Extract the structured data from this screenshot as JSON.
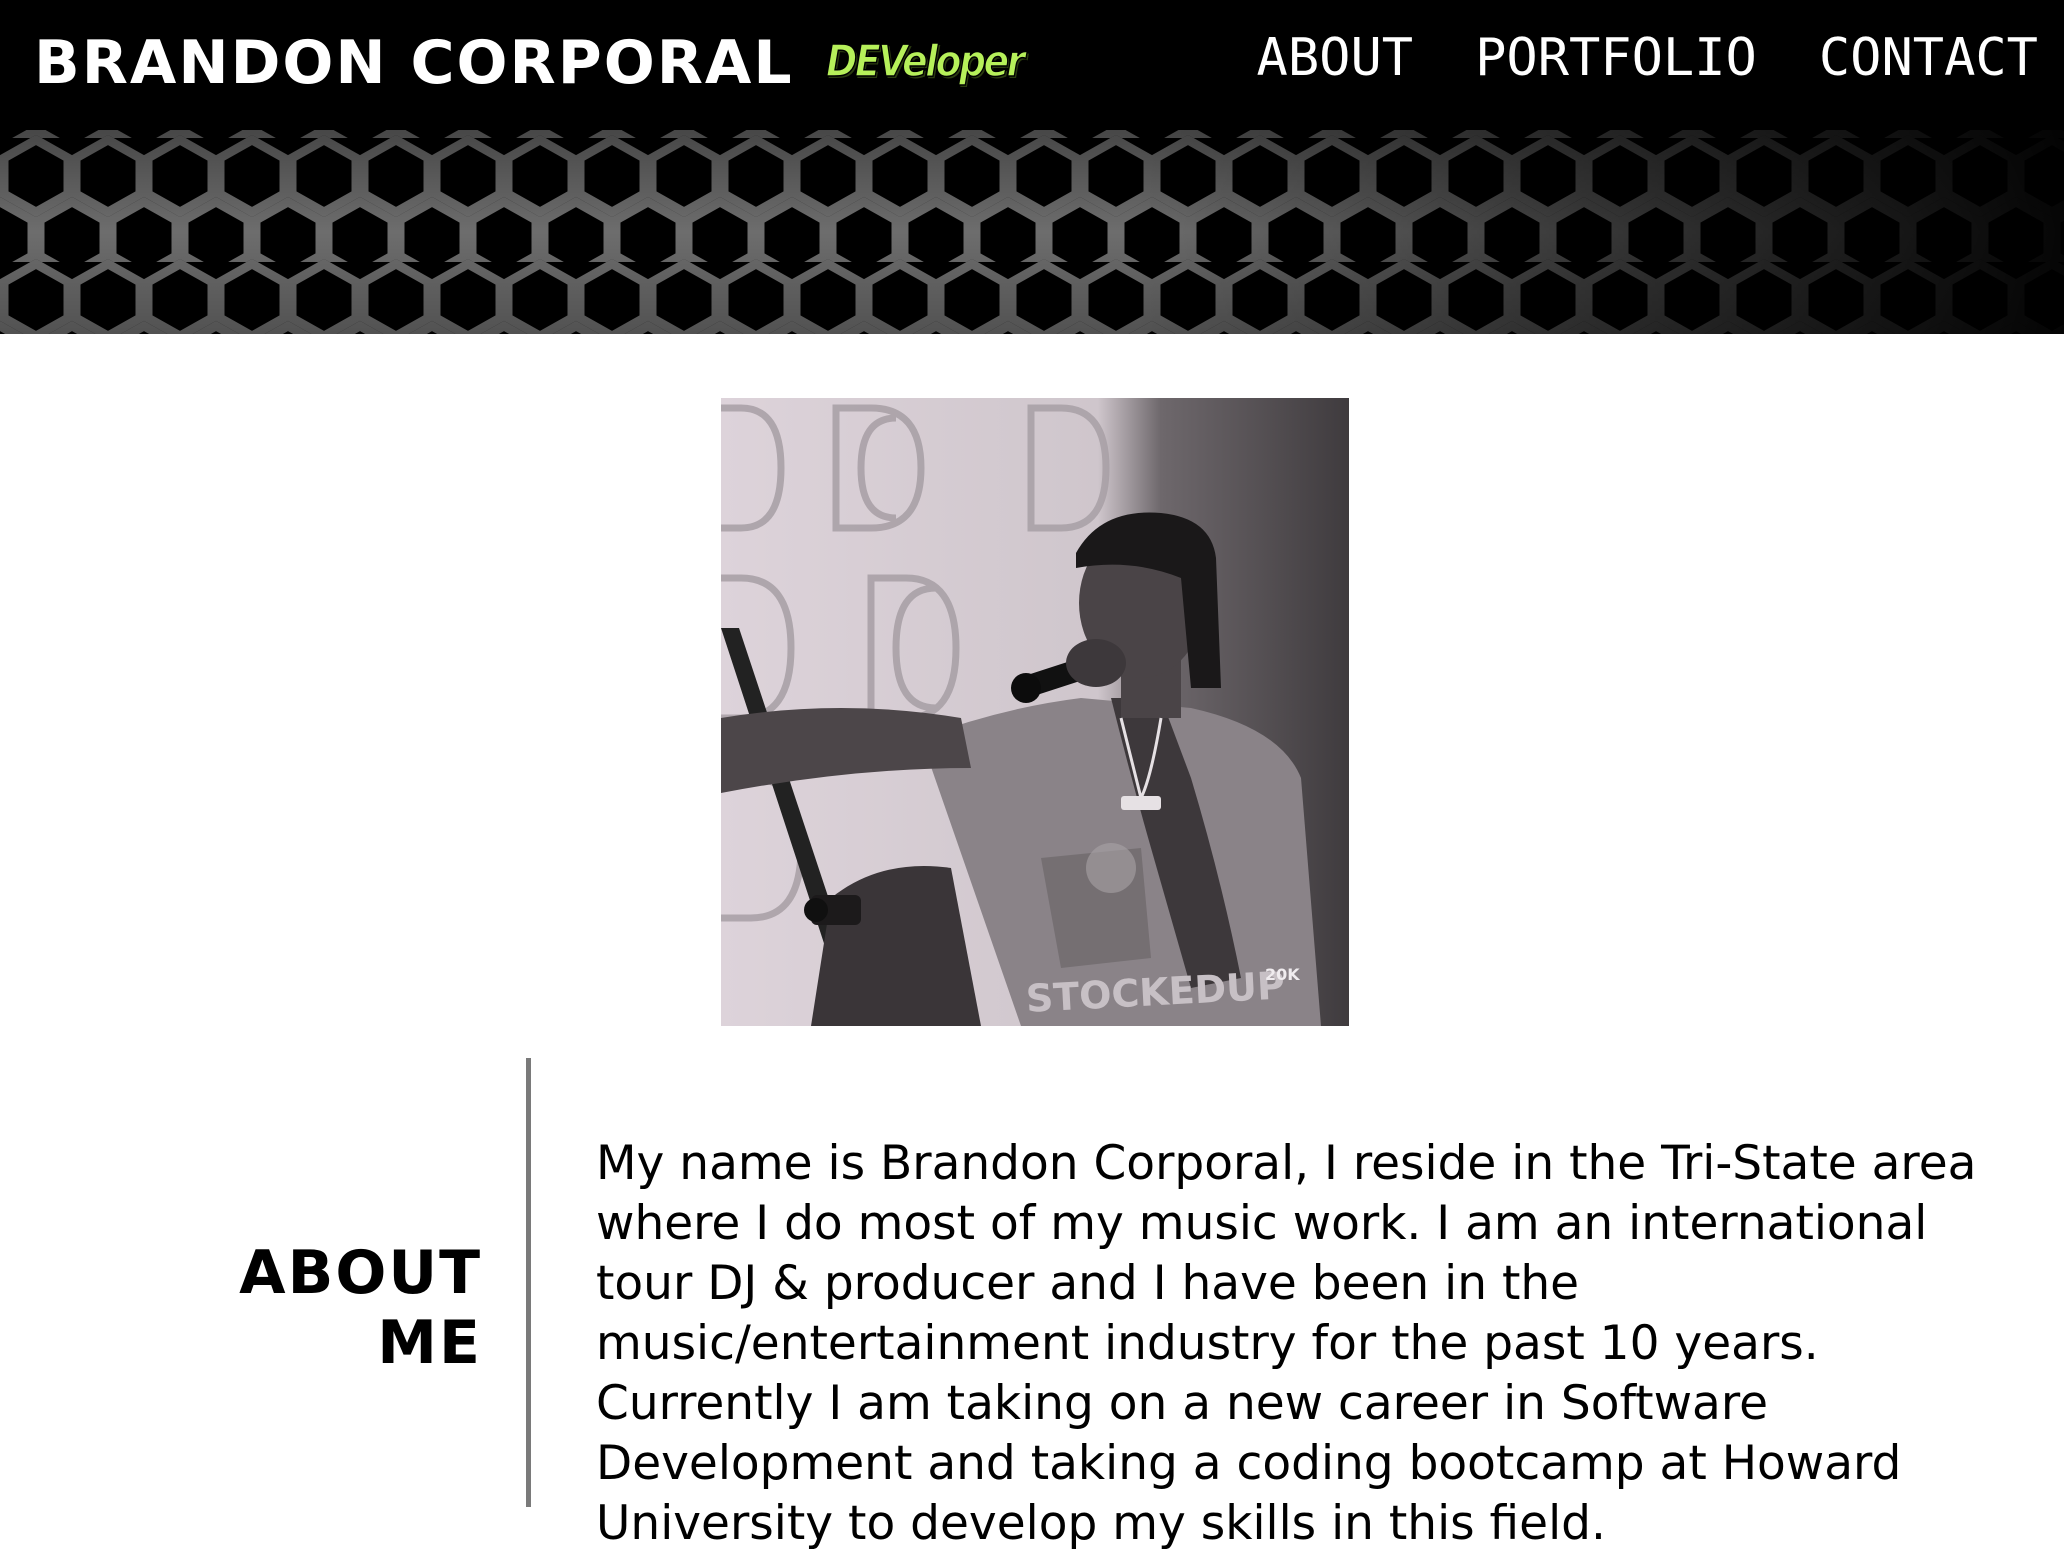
{
  "header": {
    "brand": "BRANDON CORPORAL",
    "tagline": "DEVeloper",
    "tagline_color": "#b6f05a",
    "background_pattern": "hexagon-mesh"
  },
  "nav": {
    "items": [
      {
        "label": "ABOUT"
      },
      {
        "label": "PORTFOLIO"
      },
      {
        "label": "CONTACT"
      }
    ]
  },
  "hero_photo": {
    "alt": "Black and white photo of performer with microphone",
    "shirt_text": "STOCKEDUP",
    "watermark": "20K"
  },
  "about": {
    "heading_line1": "ABOUT",
    "heading_line2": "ME",
    "paragraph": "My name is Brandon Corporal, I reside in the Tri-State area where I do most of my music work. I am an international tour DJ & producer and I have been in the music/entertainment industry for the past 10 years. Currently I am taking on a new career in Software Development and taking a coding bootcamp at Howard University to develop my skills in this field."
  }
}
